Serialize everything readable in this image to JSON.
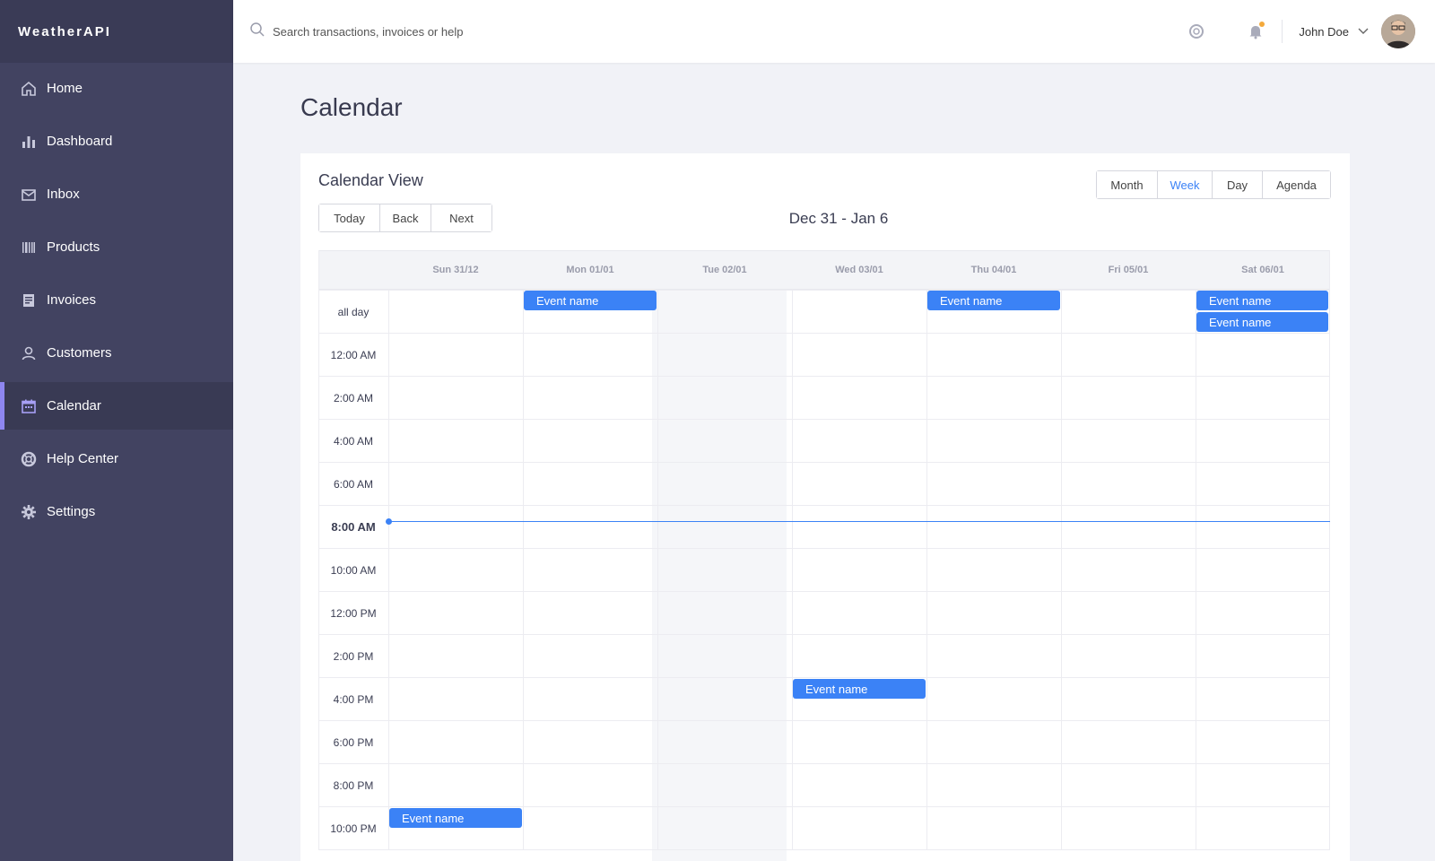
{
  "brand": "WeatherAPI",
  "sidebar": {
    "items": [
      {
        "label": "Home",
        "icon": "home-icon"
      },
      {
        "label": "Dashboard",
        "icon": "bar-chart-icon"
      },
      {
        "label": "Inbox",
        "icon": "mail-icon"
      },
      {
        "label": "Products",
        "icon": "barcode-icon"
      },
      {
        "label": "Invoices",
        "icon": "receipt-icon"
      },
      {
        "label": "Customers",
        "icon": "user-icon"
      },
      {
        "label": "Calendar",
        "icon": "calendar-icon",
        "active": true
      },
      {
        "label": "Help Center",
        "icon": "lifebuoy-icon"
      },
      {
        "label": "Settings",
        "icon": "gear-icon"
      }
    ]
  },
  "topbar": {
    "search_placeholder": "Search transactions, invoices or help",
    "user_name": "John Doe"
  },
  "page": {
    "title": "Calendar"
  },
  "calendar": {
    "card_title": "Calendar View",
    "nav_buttons": [
      "Today",
      "Back",
      "Next"
    ],
    "view_buttons": [
      "Month",
      "Week",
      "Day",
      "Agenda"
    ],
    "active_view": "Week",
    "range_label": "Dec 31 - Jan 6",
    "days": [
      "Sun 31/12",
      "Mon 01/01",
      "Tue 02/01",
      "Wed 03/01",
      "Thu 04/01",
      "Fri 05/01",
      "Sat 06/01"
    ],
    "all_day_label": "all day",
    "time_slots": [
      "12:00 AM",
      "2:00 AM",
      "4:00 AM",
      "6:00 AM",
      "8:00 AM",
      "10:00 AM",
      "12:00 PM",
      "2:00 PM",
      "4:00 PM",
      "6:00 PM",
      "8:00 PM",
      "10:00 PM"
    ],
    "current_time_label": "8:00 AM",
    "all_day_events": [
      {
        "day": "Mon 01/01",
        "name": "Event name"
      },
      {
        "day": "Thu 04/01",
        "name": "Event name"
      },
      {
        "day": "Sat 06/01",
        "name": "Event name"
      },
      {
        "day": "Sat 06/01",
        "name": "Event name"
      }
    ],
    "timed_events": [
      {
        "day": "Wed 03/01",
        "slot": "4:00 PM",
        "name": "Event name"
      },
      {
        "day": "Sun 31/12",
        "slot": "10:00 PM",
        "name": "Event name"
      }
    ],
    "colors": {
      "event": "#3b82f6",
      "accent": "#8e86f0",
      "sidebar": "#424361"
    }
  }
}
